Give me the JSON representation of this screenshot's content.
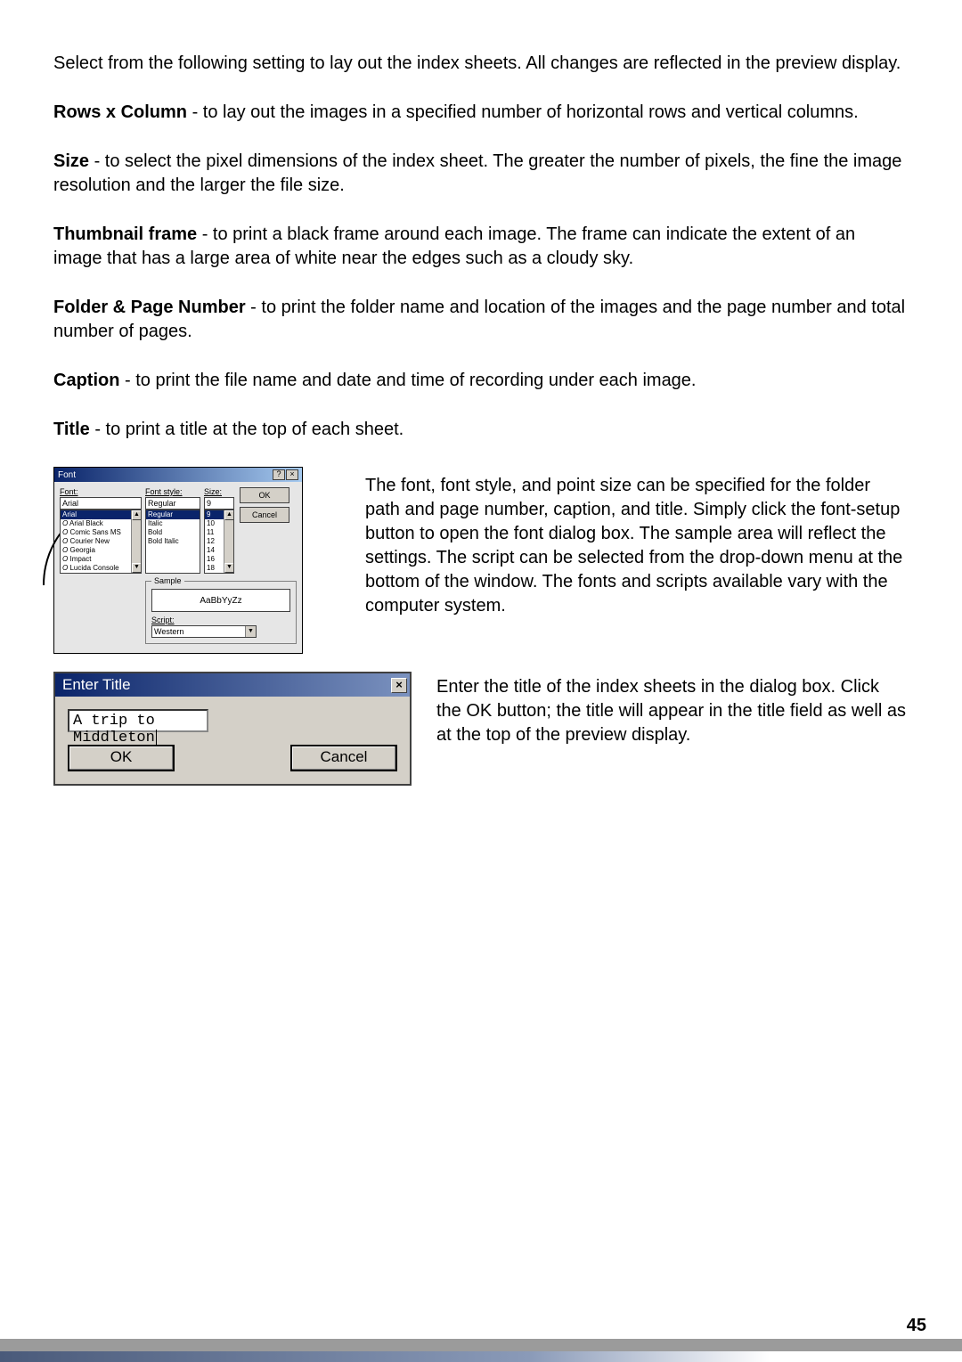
{
  "intro": "Select from the following setting to lay out the index sheets. All changes are reflected in the preview display.",
  "settings": {
    "rows": {
      "label": "Rows x Column",
      "desc": " - to lay out the images in a specified number of horizontal rows and vertical columns."
    },
    "size": {
      "label": "Size",
      "desc": " - to select the pixel dimensions of the index sheet. The greater the number of pixels, the fine the image resolution and the larger the file size."
    },
    "thumb": {
      "label": "Thumbnail frame",
      "desc": " - to print a black frame around each image. The frame can indicate the extent of an image that has a large area of white near the edges such as a cloudy sky."
    },
    "folder": {
      "label": "Folder & Page Number",
      "desc": " - to print the folder name and location of the images and the page number and total number of pages."
    },
    "caption": {
      "label": "Caption",
      "desc": " - to print the file name and date and time of recording under each image."
    },
    "title": {
      "label": "Title",
      "desc": " - to print a title at the top of each sheet."
    }
  },
  "font_dialog": {
    "title": "Font",
    "font_label": "Font:",
    "font_value": "Arial",
    "font_list": [
      "Arial",
      "Arial Black",
      "Comic Sans MS",
      "Courier New",
      "Georgia",
      "Impact",
      "Lucida Console"
    ],
    "style_label": "Font style:",
    "style_value": "Regular",
    "style_list": [
      "Regular",
      "Italic",
      "Bold",
      "Bold Italic"
    ],
    "size_label": "Size:",
    "size_value": "9",
    "size_list": [
      "9",
      "10",
      "11",
      "12",
      "14",
      "16",
      "18"
    ],
    "ok": "OK",
    "cancel": "Cancel",
    "sample_label": "Sample",
    "sample_text": "AaBbYyZz",
    "script_label": "Script:",
    "script_value": "Western"
  },
  "font_desc": "The font, font style, and point size can be specified for the folder path and page number, caption, and title. Simply click the font-setup button to open the font dialog box. The sample area will reflect the settings. The script can be selected from the drop-down menu at the bottom of the window. The fonts and scripts available vary with the computer system.",
  "title_dialog": {
    "title": "Enter Title",
    "input_value": "A trip to Middleton",
    "ok": "OK",
    "cancel": "Cancel"
  },
  "title_desc": "Enter the title of the index sheets in the dialog box. Click the OK button; the title will appear in the title field as well as at the top of the preview display.",
  "page_number": "45"
}
